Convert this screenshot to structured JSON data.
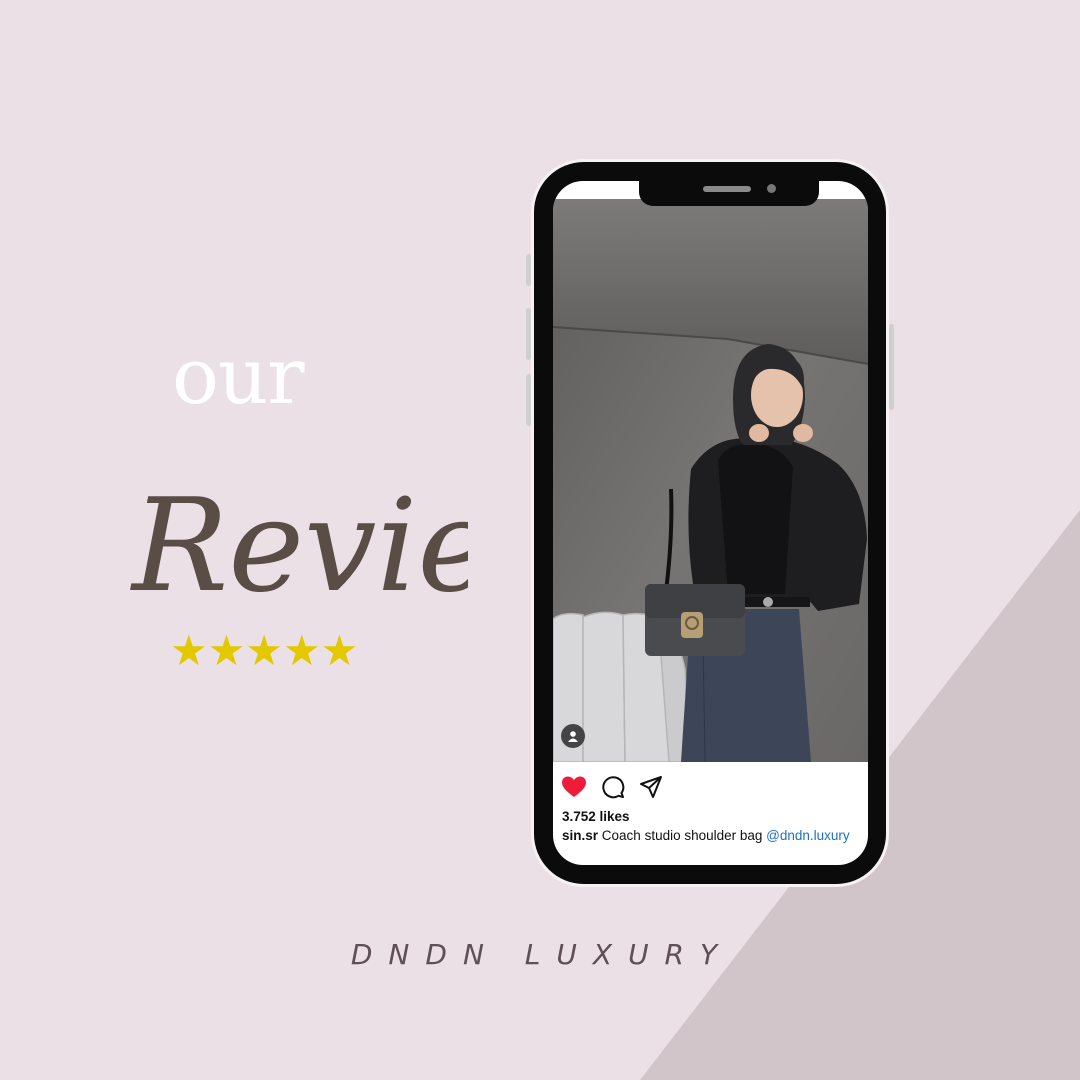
{
  "headline": {
    "small_word": "our",
    "script_word": "Review",
    "stars": "★★★★★",
    "rating": 5
  },
  "brand": "DNDN LUXURY",
  "colors": {
    "background": "#eae0e6",
    "diagonal_shape": "#d2c5ca",
    "script_text": "#5a4d46",
    "stars": "#e3c800",
    "heart": "#ed1c3a",
    "mention": "#1f6fc7"
  },
  "post": {
    "likes_text": "3.752 likes",
    "username": "sin.sr",
    "caption": "Coach studio shoulder bag",
    "mention": "@dndn.luxury",
    "liked": true,
    "icons": [
      "heart-filled-icon",
      "comment-icon",
      "share-icon",
      "user-tag-icon"
    ]
  }
}
